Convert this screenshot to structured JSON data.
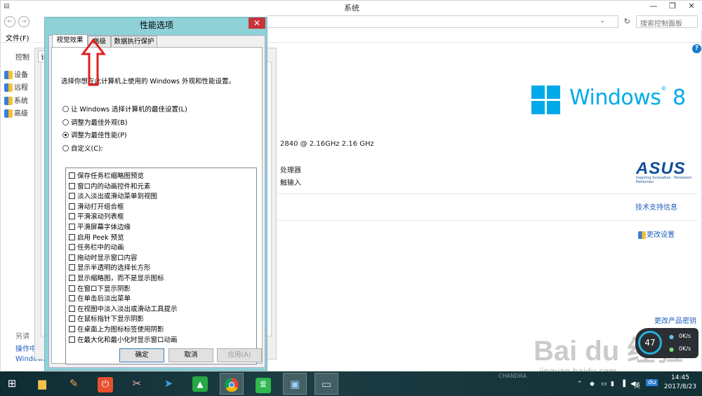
{
  "window": {
    "title": "系统",
    "controls": [
      "—",
      "❐",
      "✕"
    ]
  },
  "address": {
    "search_placeholder": "搜索控制面板"
  },
  "menu": {
    "file": "文件(F)"
  },
  "sidebar": {
    "header": "控制",
    "items": [
      {
        "label": "设备",
        "icon": "shield-icon"
      },
      {
        "label": "远程",
        "icon": "shield-icon"
      },
      {
        "label": "系统",
        "icon": "shield-icon"
      },
      {
        "label": "高级",
        "icon": "shield-icon"
      }
    ],
    "see_also": "另请",
    "bottom_links": [
      "操作中心",
      "Windows"
    ]
  },
  "behind_tab": "计",
  "right": {
    "os_brand": "Windows",
    "os_version": "8",
    "cpu": "2840  @ 2.16GHz   2.16 GHz",
    "processor_suffix": "处理器",
    "input_suffix": "触输入",
    "oem": "ASUS",
    "oem_tag": "Inspiring Innovation · Persistent Perfection",
    "support_link": "技术支持信息",
    "change_settings": "更改设置",
    "change_key": "更改产品密钥"
  },
  "dialog": {
    "title": "性能选项",
    "tabs": [
      "视觉效果",
      "高级",
      "数据执行保护"
    ],
    "description": "选择你想在此计算机上使用的 Windows 外观和性能设置。",
    "radios": [
      {
        "label": "让 Windows 选择计算机的最佳设置(L)",
        "selected": false
      },
      {
        "label": "调整为最佳外观(B)",
        "selected": false
      },
      {
        "label": "调整为最佳性能(P)",
        "selected": true
      },
      {
        "label": "自定义(C):",
        "selected": false
      }
    ],
    "effects": [
      "保存任务栏缩略图预览",
      "窗口内的动画控件和元素",
      "淡入淡出或滑动菜单到视图",
      "滑动打开组合框",
      "平滑滚动列表框",
      "平滑屏幕字体边缘",
      "启用 Peek 预览",
      "任务栏中的动画",
      "拖动时显示窗口内容",
      "显示半透明的选择长方形",
      "显示缩略图，而不是显示图标",
      "在窗口下显示阴影",
      "在单击后淡出菜单",
      "在视图中淡入淡出或滑动工具提示",
      "在鼠标指针下显示阴影",
      "在桌面上为图标标签使用阴影",
      "在最大化和最小化时显示窗口动画"
    ],
    "buttons": {
      "ok": "确定",
      "cancel": "取消",
      "apply": "应用(A)"
    }
  },
  "net_widget": {
    "up": "0K/s",
    "down": "0K/s",
    "badge": "47"
  },
  "watermark": {
    "main": "Bai du 经验",
    "sub": "jingyan.baidu.com"
  },
  "chandra": "CHANDRA",
  "taskbar": {
    "apps": [
      {
        "icon": "windows-start-icon",
        "glyph": "⊞"
      },
      {
        "icon": "file-explorer-icon",
        "glyph": "🗀"
      },
      {
        "icon": "paint-icon",
        "glyph": "🎨"
      },
      {
        "icon": "power-app-icon",
        "glyph": "⏻"
      },
      {
        "icon": "scissors-app-icon",
        "glyph": "✂"
      },
      {
        "icon": "bird-app-icon",
        "glyph": "✈"
      },
      {
        "icon": "green-app-icon",
        "glyph": "▲"
      },
      {
        "icon": "chrome-icon",
        "glyph": "◉"
      },
      {
        "icon": "iqiyi-icon",
        "glyph": "爱"
      },
      {
        "icon": "control-panel-icon",
        "glyph": "▣"
      },
      {
        "icon": "system-window-icon",
        "glyph": "🖥"
      }
    ],
    "ime": "英",
    "time": "14:45",
    "date": "2017/8/23"
  },
  "colors": {
    "dialog_frame": "#8ed1d7",
    "close": "#c7343a",
    "win8": "#00aae9",
    "arrow": "#e02020",
    "link": "#1f5dbb"
  }
}
